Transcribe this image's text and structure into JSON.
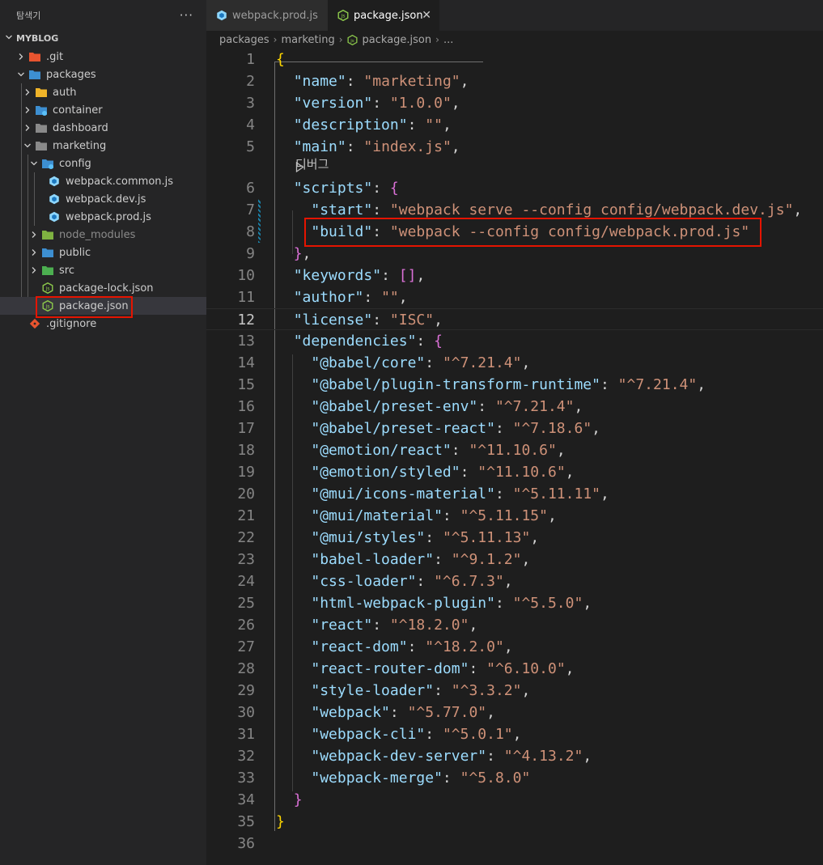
{
  "sidebar": {
    "title": "탐색기",
    "more_label": "···",
    "root": {
      "label": "MYBLOG"
    },
    "items": [
      {
        "label": ".git",
        "icon": "git-folder-icon"
      },
      {
        "label": "packages",
        "icon": "packages-folder-icon"
      },
      {
        "label": "auth",
        "icon": "auth-folder-icon"
      },
      {
        "label": "container",
        "icon": "container-folder-icon"
      },
      {
        "label": "dashboard",
        "icon": "folder-icon"
      },
      {
        "label": "marketing",
        "icon": "folder-open-icon"
      },
      {
        "label": "config",
        "icon": "config-folder-icon"
      },
      {
        "label": "webpack.common.js",
        "icon": "webpack-icon"
      },
      {
        "label": "webpack.dev.js",
        "icon": "webpack-icon"
      },
      {
        "label": "webpack.prod.js",
        "icon": "webpack-icon"
      },
      {
        "label": "node_modules",
        "icon": "node-modules-folder-icon"
      },
      {
        "label": "public",
        "icon": "public-folder-icon"
      },
      {
        "label": "src",
        "icon": "src-folder-icon"
      },
      {
        "label": "package-lock.json",
        "icon": "nodejs-icon"
      },
      {
        "label": "package.json",
        "icon": "nodejs-icon",
        "selected": true
      },
      {
        "label": ".gitignore",
        "icon": "git-icon"
      }
    ]
  },
  "tabs": [
    {
      "label": "webpack.prod.js",
      "icon": "webpack-icon",
      "active": false
    },
    {
      "label": "package.json",
      "icon": "nodejs-icon",
      "active": true,
      "close": "✕"
    }
  ],
  "breadcrumb": [
    "packages",
    "marketing",
    "package.json",
    "..."
  ],
  "editor": {
    "current_line": 12,
    "codelens_label": "디버그",
    "lines": [
      {
        "n": "1",
        "t": [
          [
            "b1",
            "{"
          ]
        ]
      },
      {
        "n": "2",
        "t": [
          [
            "p",
            "  "
          ],
          [
            "k",
            "\"name\""
          ],
          [
            "p",
            ": "
          ],
          [
            "s",
            "\"marketing\""
          ],
          [
            "p",
            ","
          ]
        ]
      },
      {
        "n": "3",
        "t": [
          [
            "p",
            "  "
          ],
          [
            "k",
            "\"version\""
          ],
          [
            "p",
            ": "
          ],
          [
            "s",
            "\"1.0.0\""
          ],
          [
            "p",
            ","
          ]
        ]
      },
      {
        "n": "4",
        "t": [
          [
            "p",
            "  "
          ],
          [
            "k",
            "\"description\""
          ],
          [
            "p",
            ": "
          ],
          [
            "s",
            "\"\""
          ],
          [
            "p",
            ","
          ]
        ]
      },
      {
        "n": "5",
        "t": [
          [
            "p",
            "  "
          ],
          [
            "k",
            "\"main\""
          ],
          [
            "p",
            ": "
          ],
          [
            "s",
            "\"index.js\""
          ],
          [
            "p",
            ","
          ]
        ]
      },
      {
        "n": "6",
        "t": [
          [
            "p",
            "  "
          ],
          [
            "k",
            "\"scripts\""
          ],
          [
            "p",
            ": "
          ],
          [
            "b2",
            "{"
          ]
        ]
      },
      {
        "n": "7",
        "t": [
          [
            "p",
            "    "
          ],
          [
            "k",
            "\"start\""
          ],
          [
            "p",
            ": "
          ],
          [
            "s",
            "\"webpack serve --config config/webpack.dev.js\""
          ],
          [
            "p",
            ","
          ]
        ]
      },
      {
        "n": "8",
        "t": [
          [
            "p",
            "    "
          ],
          [
            "k",
            "\"build\""
          ],
          [
            "p",
            ": "
          ],
          [
            "s",
            "\"webpack --config config/webpack.prod.js\""
          ]
        ]
      },
      {
        "n": "9",
        "t": [
          [
            "p",
            "  "
          ],
          [
            "b2",
            "}"
          ],
          [
            "p",
            ","
          ]
        ]
      },
      {
        "n": "10",
        "t": [
          [
            "p",
            "  "
          ],
          [
            "k",
            "\"keywords\""
          ],
          [
            "p",
            ": "
          ],
          [
            "b2",
            "[]"
          ],
          [
            "p",
            ","
          ]
        ]
      },
      {
        "n": "11",
        "t": [
          [
            "p",
            "  "
          ],
          [
            "k",
            "\"author\""
          ],
          [
            "p",
            ": "
          ],
          [
            "s",
            "\"\""
          ],
          [
            "p",
            ","
          ]
        ]
      },
      {
        "n": "12",
        "t": [
          [
            "p",
            "  "
          ],
          [
            "k",
            "\"license\""
          ],
          [
            "p",
            ": "
          ],
          [
            "s",
            "\"ISC\""
          ],
          [
            "p",
            ","
          ]
        ]
      },
      {
        "n": "13",
        "t": [
          [
            "p",
            "  "
          ],
          [
            "k",
            "\"dependencies\""
          ],
          [
            "p",
            ": "
          ],
          [
            "b2",
            "{"
          ]
        ]
      },
      {
        "n": "14",
        "t": [
          [
            "p",
            "    "
          ],
          [
            "k",
            "\"@babel/core\""
          ],
          [
            "p",
            ": "
          ],
          [
            "s",
            "\"^7.21.4\""
          ],
          [
            "p",
            ","
          ]
        ]
      },
      {
        "n": "15",
        "t": [
          [
            "p",
            "    "
          ],
          [
            "k",
            "\"@babel/plugin-transform-runtime\""
          ],
          [
            "p",
            ": "
          ],
          [
            "s",
            "\"^7.21.4\""
          ],
          [
            "p",
            ","
          ]
        ]
      },
      {
        "n": "16",
        "t": [
          [
            "p",
            "    "
          ],
          [
            "k",
            "\"@babel/preset-env\""
          ],
          [
            "p",
            ": "
          ],
          [
            "s",
            "\"^7.21.4\""
          ],
          [
            "p",
            ","
          ]
        ]
      },
      {
        "n": "17",
        "t": [
          [
            "p",
            "    "
          ],
          [
            "k",
            "\"@babel/preset-react\""
          ],
          [
            "p",
            ": "
          ],
          [
            "s",
            "\"^7.18.6\""
          ],
          [
            "p",
            ","
          ]
        ]
      },
      {
        "n": "18",
        "t": [
          [
            "p",
            "    "
          ],
          [
            "k",
            "\"@emotion/react\""
          ],
          [
            "p",
            ": "
          ],
          [
            "s",
            "\"^11.10.6\""
          ],
          [
            "p",
            ","
          ]
        ]
      },
      {
        "n": "19",
        "t": [
          [
            "p",
            "    "
          ],
          [
            "k",
            "\"@emotion/styled\""
          ],
          [
            "p",
            ": "
          ],
          [
            "s",
            "\"^11.10.6\""
          ],
          [
            "p",
            ","
          ]
        ]
      },
      {
        "n": "20",
        "t": [
          [
            "p",
            "    "
          ],
          [
            "k",
            "\"@mui/icons-material\""
          ],
          [
            "p",
            ": "
          ],
          [
            "s",
            "\"^5.11.11\""
          ],
          [
            "p",
            ","
          ]
        ]
      },
      {
        "n": "21",
        "t": [
          [
            "p",
            "    "
          ],
          [
            "k",
            "\"@mui/material\""
          ],
          [
            "p",
            ": "
          ],
          [
            "s",
            "\"^5.11.15\""
          ],
          [
            "p",
            ","
          ]
        ]
      },
      {
        "n": "22",
        "t": [
          [
            "p",
            "    "
          ],
          [
            "k",
            "\"@mui/styles\""
          ],
          [
            "p",
            ": "
          ],
          [
            "s",
            "\"^5.11.13\""
          ],
          [
            "p",
            ","
          ]
        ]
      },
      {
        "n": "23",
        "t": [
          [
            "p",
            "    "
          ],
          [
            "k",
            "\"babel-loader\""
          ],
          [
            "p",
            ": "
          ],
          [
            "s",
            "\"^9.1.2\""
          ],
          [
            "p",
            ","
          ]
        ]
      },
      {
        "n": "24",
        "t": [
          [
            "p",
            "    "
          ],
          [
            "k",
            "\"css-loader\""
          ],
          [
            "p",
            ": "
          ],
          [
            "s",
            "\"^6.7.3\""
          ],
          [
            "p",
            ","
          ]
        ]
      },
      {
        "n": "25",
        "t": [
          [
            "p",
            "    "
          ],
          [
            "k",
            "\"html-webpack-plugin\""
          ],
          [
            "p",
            ": "
          ],
          [
            "s",
            "\"^5.5.0\""
          ],
          [
            "p",
            ","
          ]
        ]
      },
      {
        "n": "26",
        "t": [
          [
            "p",
            "    "
          ],
          [
            "k",
            "\"react\""
          ],
          [
            "p",
            ": "
          ],
          [
            "s",
            "\"^18.2.0\""
          ],
          [
            "p",
            ","
          ]
        ]
      },
      {
        "n": "27",
        "t": [
          [
            "p",
            "    "
          ],
          [
            "k",
            "\"react-dom\""
          ],
          [
            "p",
            ": "
          ],
          [
            "s",
            "\"^18.2.0\""
          ],
          [
            "p",
            ","
          ]
        ]
      },
      {
        "n": "28",
        "t": [
          [
            "p",
            "    "
          ],
          [
            "k",
            "\"react-router-dom\""
          ],
          [
            "p",
            ": "
          ],
          [
            "s",
            "\"^6.10.0\""
          ],
          [
            "p",
            ","
          ]
        ]
      },
      {
        "n": "29",
        "t": [
          [
            "p",
            "    "
          ],
          [
            "k",
            "\"style-loader\""
          ],
          [
            "p",
            ": "
          ],
          [
            "s",
            "\"^3.3.2\""
          ],
          [
            "p",
            ","
          ]
        ]
      },
      {
        "n": "30",
        "t": [
          [
            "p",
            "    "
          ],
          [
            "k",
            "\"webpack\""
          ],
          [
            "p",
            ": "
          ],
          [
            "s",
            "\"^5.77.0\""
          ],
          [
            "p",
            ","
          ]
        ]
      },
      {
        "n": "31",
        "t": [
          [
            "p",
            "    "
          ],
          [
            "k",
            "\"webpack-cli\""
          ],
          [
            "p",
            ": "
          ],
          [
            "s",
            "\"^5.0.1\""
          ],
          [
            "p",
            ","
          ]
        ]
      },
      {
        "n": "32",
        "t": [
          [
            "p",
            "    "
          ],
          [
            "k",
            "\"webpack-dev-server\""
          ],
          [
            "p",
            ": "
          ],
          [
            "s",
            "\"^4.13.2\""
          ],
          [
            "p",
            ","
          ]
        ]
      },
      {
        "n": "33",
        "t": [
          [
            "p",
            "    "
          ],
          [
            "k",
            "\"webpack-merge\""
          ],
          [
            "p",
            ": "
          ],
          [
            "s",
            "\"^5.8.0\""
          ]
        ]
      },
      {
        "n": "34",
        "t": [
          [
            "p",
            "  "
          ],
          [
            "b2",
            "}"
          ]
        ]
      },
      {
        "n": "35",
        "t": [
          [
            "b1",
            "}"
          ]
        ]
      },
      {
        "n": "36",
        "t": []
      }
    ]
  },
  "colors": {
    "accent_highlight": "#e51400",
    "json_key": "#9cdcfe",
    "json_string": "#ce9178",
    "bracket_level1": "#ffd700",
    "bracket_level2": "#da70d6"
  }
}
